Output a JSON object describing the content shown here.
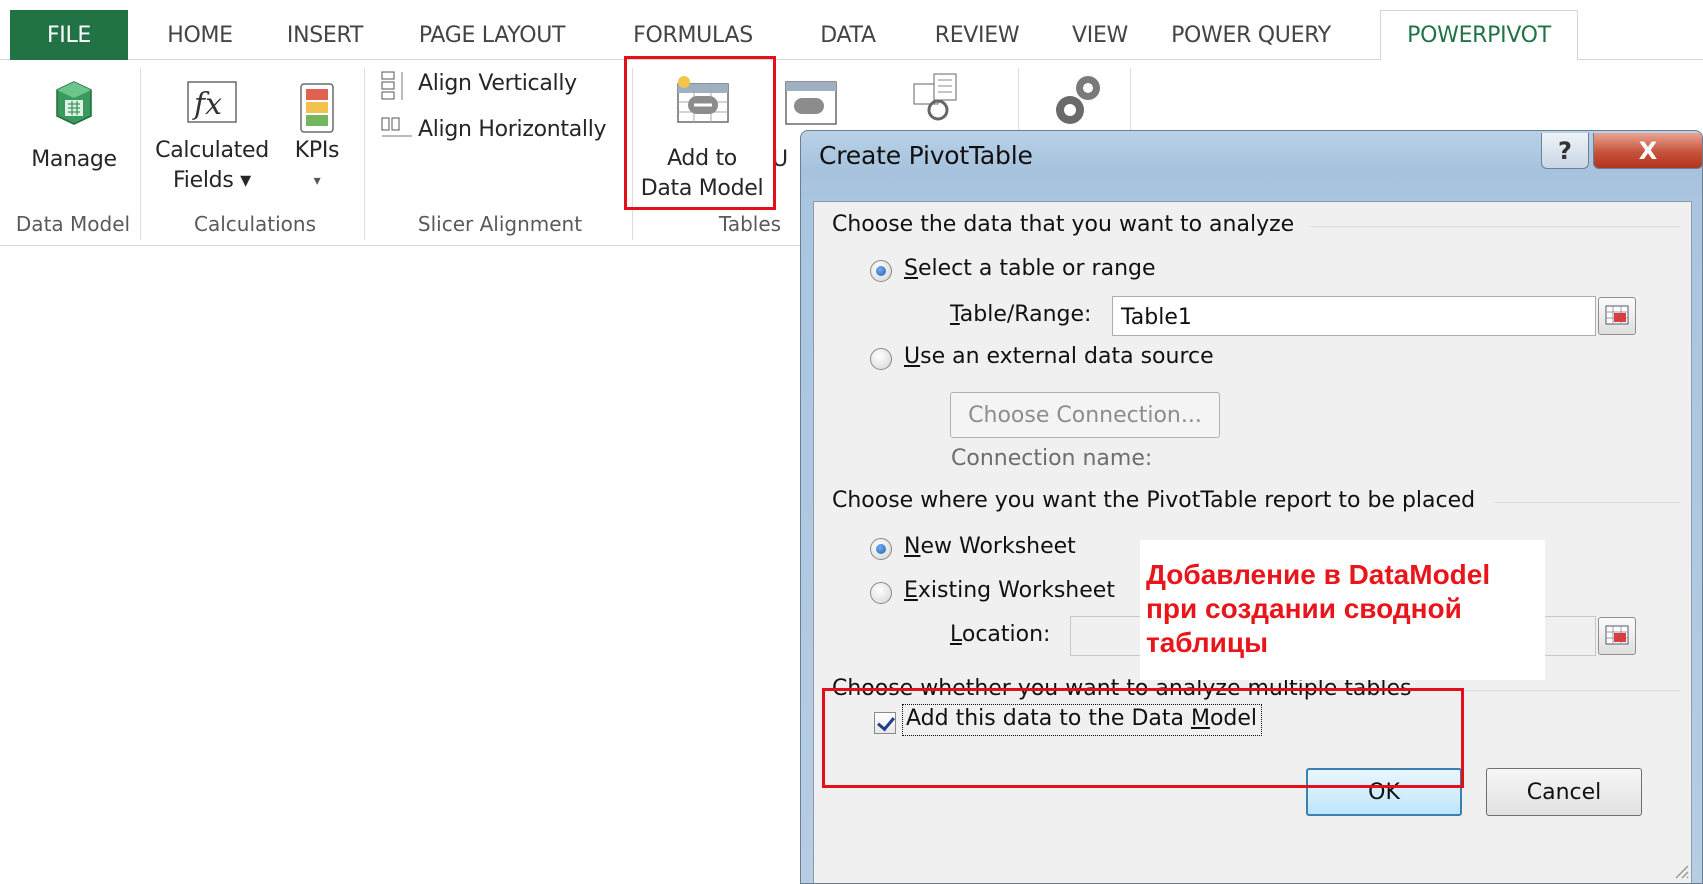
{
  "tabs": {
    "file": "FILE",
    "home": "HOME",
    "insert": "INSERT",
    "page_layout": "PAGE LAYOUT",
    "formulas": "FORMULAS",
    "data": "DATA",
    "review": "REVIEW",
    "view": "VIEW",
    "power_query": "POWER QUERY",
    "powerpivot": "POWERPIVOT"
  },
  "ribbon": {
    "manage": "Manage",
    "calculated_fields_line1": "Calculated",
    "calculated_fields_line2": "Fields ▾",
    "kpis": "KPIs",
    "kpis_arrow": "▾",
    "align_vertically": "Align Vertically",
    "align_horizontally": "Align Horizontally",
    "add_to_line1": "Add to",
    "add_to_line2": "Data Model",
    "update_partial": "U",
    "groups": {
      "data_model": "Data Model",
      "calculations": "Calculations",
      "slicer_alignment": "Slicer Alignment",
      "tables": "Tables"
    }
  },
  "dialog": {
    "title": "Create PivotTable",
    "help_button": "?",
    "close_button": "X",
    "section_analyze": "Choose the data that you want to analyze",
    "opt_table_range_accel": "S",
    "opt_table_range_rest": "elect a table or range",
    "table_range_label_accel": "T",
    "table_range_label_rest": "able/Range:",
    "table_range_value": "Table1",
    "opt_external_accel": "U",
    "opt_external_rest": "se an external data source",
    "choose_connection": "Choose Connection...",
    "connection_name_label": "Connection name:",
    "section_placement": "Choose where you want the PivotTable report to be placed",
    "opt_new_ws_accel": "N",
    "opt_new_ws_rest": "ew Worksheet",
    "opt_existing_ws_accel": "E",
    "opt_existing_ws_rest": "xisting Worksheet",
    "location_label_accel": "L",
    "location_label_rest": "ocation:",
    "location_value": "",
    "section_multiple": "Choose whether you want to analyze multiple tables",
    "add_to_model_pre": "Add this data to the Data ",
    "add_to_model_accel": "M",
    "add_to_model_post": "odel",
    "add_to_model_checked": true,
    "ok": "OK",
    "cancel": "Cancel"
  },
  "annotation": "Добавление в DataModel\nпри создании сводной\nтаблицы",
  "colors": {
    "excel_green": "#217346",
    "highlight_red": "#e3101a",
    "annotation_red": "#e8151b"
  }
}
